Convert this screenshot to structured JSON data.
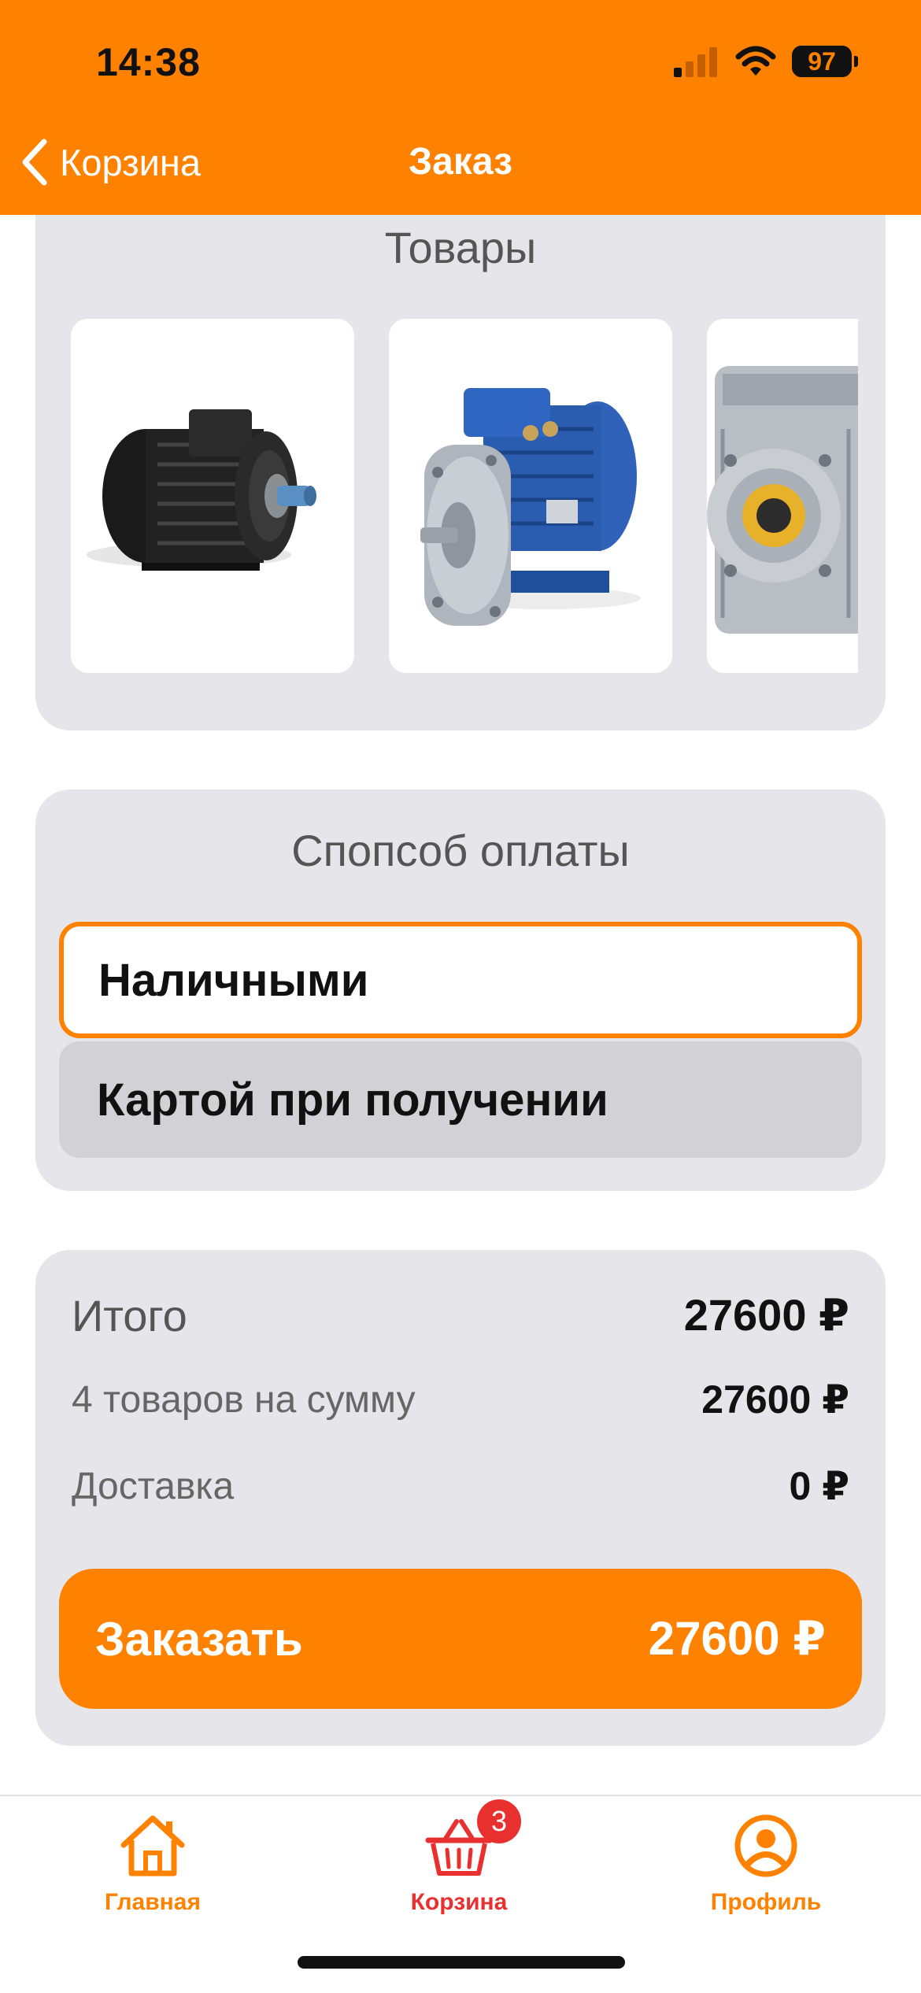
{
  "status_bar": {
    "time": "14:38",
    "battery": "97"
  },
  "header": {
    "back_label": "Корзина",
    "title": "Заказ"
  },
  "products": {
    "title": "Товары",
    "items": [
      {
        "name": "black-electric-motor"
      },
      {
        "name": "blue-electric-motor"
      },
      {
        "name": "silver-worm-gearbox"
      }
    ]
  },
  "payment": {
    "title": "Спопсоб оплаты",
    "options": [
      {
        "label": "Наличными",
        "selected": true
      },
      {
        "label": "Картой при получении",
        "selected": false
      }
    ]
  },
  "summary": {
    "total_label": "Итого",
    "total_value": "27600 ₽",
    "items_label": "4 товаров на сумму",
    "items_value": "27600 ₽",
    "delivery_label": "Доставка",
    "delivery_value": "0 ₽",
    "order_button_label": "Заказать",
    "order_button_value": "27600 ₽"
  },
  "tabbar": {
    "items": [
      {
        "label": "Главная",
        "icon": "home-icon"
      },
      {
        "label": "Корзина",
        "icon": "basket-icon",
        "badge": "3"
      },
      {
        "label": "Профиль",
        "icon": "profile-icon"
      }
    ]
  },
  "colors": {
    "accent": "#FF8100",
    "card_bg": "#E5E5EA",
    "badge": "#E8312F"
  }
}
